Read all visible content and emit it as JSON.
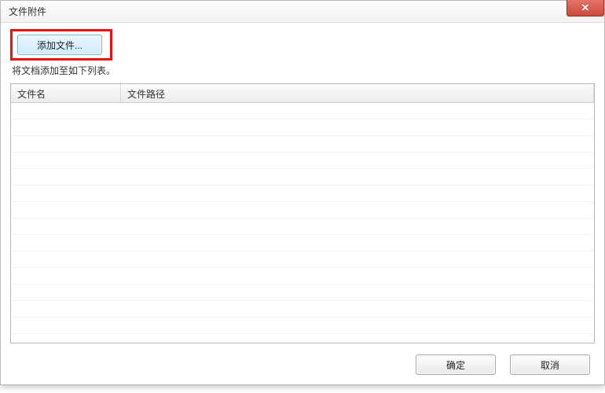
{
  "title": "文件附件",
  "addButton": "添加文件...",
  "hint": "将文档添加至如下列表。",
  "columns": {
    "name": "文件名",
    "path": "文件路径"
  },
  "rows": [],
  "buttons": {
    "ok": "确定",
    "cancel": "取消"
  }
}
